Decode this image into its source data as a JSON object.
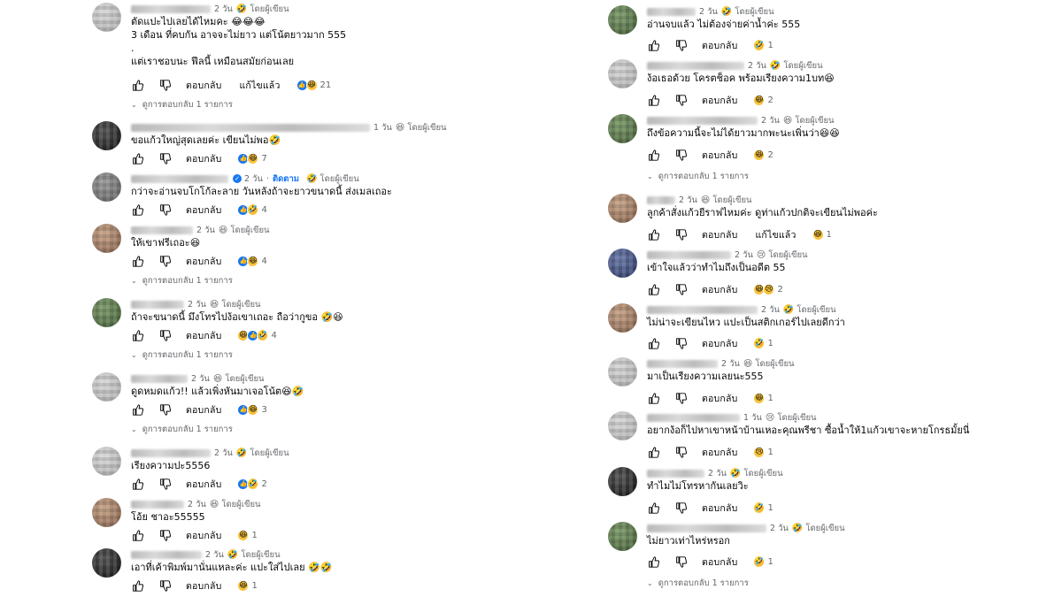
{
  "author_label": "โดยผู้เขียน",
  "reply_label": "ตอบกลับ",
  "edited_label": "แก้ไขแล้ว",
  "view_replies_label": "ดูการตอบกลับ 1 รายการ",
  "follow_label": "ติดตาม",
  "left": [
    {
      "time": "2 วัน",
      "body": "ตัดแปะไปเลยได้ไหมคะ 😂😂😂\n3 เดือน ที่คบกัน อาจจะไม่ยาว แต่โน้ตยาวมาก 555\n.\nแต่เราชอบนะ ฟีลนี้ เหมือนสมัยก่อนเลย",
      "count": "21",
      "edited": true,
      "replies": true
    },
    {
      "time": "1 วัน",
      "body": "ขอแก้วใหญ่สุดเลยค่ะ เขียนไม่พอ🤣",
      "count": "7",
      "edited": false,
      "replies": false
    },
    {
      "time": "2 วัน",
      "body": "กว่าจะอ่านจบโกโก้ละลาย วันหลังถ้าจะยาวขนาดนี้ ส่งเมลเถอะ",
      "count": "4",
      "edited": false,
      "replies": false
    },
    {
      "time": "2 วัน",
      "body": "ให้เขาฟรีเถอะ😆",
      "count": "4",
      "edited": false,
      "replies": true
    },
    {
      "time": "2 วัน",
      "body": "ถ้าจะขนาดนี้ มึงโทรไปง้อเขาเถอะ ถือว่ากูขอ 🤣😆",
      "count": "4",
      "edited": false,
      "replies": true
    },
    {
      "time": "2 วัน",
      "body": "ดูดหมดแก้ว!! แล้วเพิ่งหันมาเจอโน้ต😆🤣",
      "count": "3",
      "edited": false,
      "replies": true
    },
    {
      "time": "2 วัน",
      "body": "เรียงความปะ5556",
      "count": "2",
      "edited": false,
      "replies": false
    },
    {
      "time": "2 วัน",
      "body": "โอ้ย ชาอะ55555",
      "count": "1",
      "edited": false,
      "replies": false
    },
    {
      "time": "2 วัน",
      "body": "เอาที่เค้าพิมพ์มานั่นแหละค่ะ แปะใส่ไปเลย 🤣🤣",
      "count": "1",
      "edited": false,
      "replies": false
    }
  ],
  "right": [
    {
      "time": "2 วัน",
      "body": "อ่านจบแล้ว ไม่ต้องจ่ายค่าน้ำค่ะ 555",
      "count": "1",
      "edited": false,
      "replies": false
    },
    {
      "time": "2 วัน",
      "body": "ง้อเธอด้วย โครตช็อค พร้อมเรียงความ1บท😆",
      "count": "2",
      "edited": false,
      "replies": false
    },
    {
      "time": "2 วัน",
      "body": "ถึงข้อความนี้จะไม่ได้ยาวมากพะนะเพิ่นว่า😆😆",
      "count": "2",
      "edited": false,
      "replies": true
    },
    {
      "time": "2 วัน",
      "body": "ลูกค้าสั่งแก้วยีราฟไหมค่ะ ดูท่าแก้วปกติจะเขียนไม่พอค่ะ",
      "count": "1",
      "edited": true,
      "replies": false
    },
    {
      "time": "2 วัน",
      "body": "เข้าใจแล้วว่าทำไมถึงเป็นอดีต 55",
      "count": "2",
      "edited": false,
      "replies": false
    },
    {
      "time": "2 วัน",
      "body": "ไม่น่าจะเขียนไหว แปะเป็นสติกเกอร์ไปเลยดีกว่า",
      "count": "1",
      "edited": false,
      "replies": false
    },
    {
      "time": "2 วัน",
      "body": "มาเป็นเรียงความเลยนะ555",
      "count": "1",
      "edited": false,
      "replies": false
    },
    {
      "time": "1 วัน",
      "body": "อยากง้อก็ไปหาเขาหน้าบ้านเหอะคุณพรีชา ซื้อน้ำให้1แก้วเขาจะหายโกรธมั้ยนี่",
      "count": "1",
      "edited": false,
      "replies": false
    },
    {
      "time": "2 วัน",
      "body": "ทำไมไม่โทรหากันเลยวิะ",
      "count": "1",
      "edited": false,
      "replies": false
    },
    {
      "time": "2 วัน",
      "body": "ไม่ยาวเท่าไหร่หรอก",
      "count": "1",
      "edited": false,
      "replies": true
    }
  ]
}
